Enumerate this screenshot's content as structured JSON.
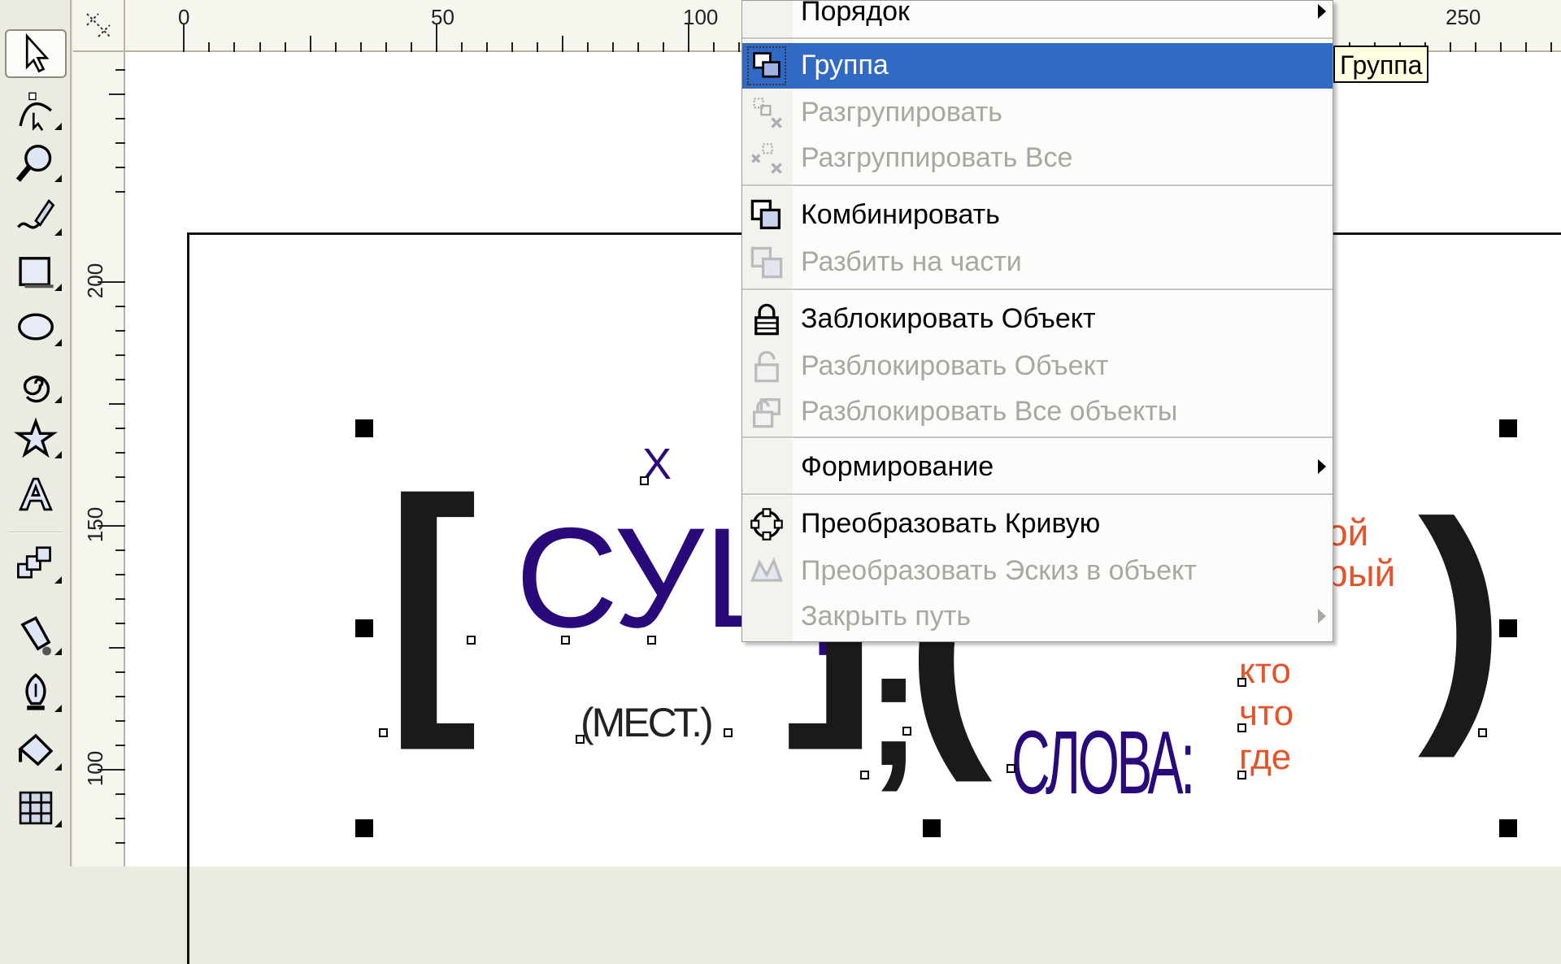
{
  "ruler": {
    "h_labels": [
      "0",
      "50",
      "100",
      "250"
    ],
    "v_labels": [
      "200",
      "150",
      "100"
    ]
  },
  "toolbox": {
    "tools": [
      {
        "name": "pick-tool",
        "icon": "arrow-pointer-icon",
        "active": true
      },
      {
        "name": "shape-tool",
        "icon": "shape-node-icon"
      },
      {
        "name": "zoom-tool",
        "icon": "magnifier-icon"
      },
      {
        "name": "freehand-tool",
        "icon": "pen-curve-icon"
      },
      {
        "name": "rectangle-tool",
        "icon": "rectangle-icon"
      },
      {
        "name": "ellipse-tool",
        "icon": "ellipse-icon"
      },
      {
        "name": "spiral-tool",
        "icon": "spiral-icon"
      },
      {
        "name": "star-tool",
        "icon": "star-icon"
      },
      {
        "name": "text-tool",
        "icon": "text-a-icon"
      },
      {
        "name": "blend-tool",
        "icon": "blend-icon"
      },
      {
        "name": "eyedropper-tool",
        "icon": "eyedropper-icon"
      },
      {
        "name": "outline-tool",
        "icon": "pen-nib-icon"
      },
      {
        "name": "fill-tool",
        "icon": "paint-bucket-icon"
      },
      {
        "name": "interactive-fill-tool",
        "icon": "mesh-grid-icon"
      }
    ]
  },
  "canvas": {
    "text_main": "СУЩ",
    "text_x": "Х",
    "text_mest": "(МЕСТ.)",
    "text_slova": "СЛОВА:",
    "text_orange_1": "ой",
    "text_orange_2": "рый",
    "text_kto": "кто",
    "text_chto": "что",
    "text_gde": "где",
    "bracket_open": "[",
    "bracket_close": "]",
    "semicolon": ";",
    "paren_open": "(",
    "paren_close": ")",
    "colors": {
      "purple": "#2a0a7a",
      "orange": "#e4542a",
      "black": "#1a1a1a"
    }
  },
  "context_menu": {
    "highlight_color": "#316ac5",
    "items": [
      {
        "label": "Порядок",
        "submenu": true,
        "disabled": false,
        "icon": ""
      },
      {
        "label": "Группа",
        "highlight": true,
        "disabled": false,
        "icon": "group-icon"
      },
      {
        "label": "Разгрупировать",
        "disabled": true,
        "icon": "ungroup-icon"
      },
      {
        "label": "Разгруппировать Все",
        "disabled": true,
        "icon": "ungroup-all-icon"
      },
      {
        "label": "Комбинировать",
        "disabled": false,
        "icon": "combine-icon"
      },
      {
        "label": "Разбить  на части",
        "disabled": true,
        "icon": "break-apart-icon"
      },
      {
        "label": "Заблокировать Объект",
        "disabled": false,
        "icon": "lock-icon"
      },
      {
        "label": "Разблокировать Объект",
        "disabled": true,
        "icon": "unlock-icon"
      },
      {
        "label": "Разблокировать Все объекты",
        "disabled": true,
        "icon": "unlock-all-icon"
      },
      {
        "label": "Формирование",
        "submenu": true,
        "disabled": false,
        "icon": ""
      },
      {
        "label": "Преобразовать Кривую",
        "disabled": false,
        "icon": "convert-curve-icon"
      },
      {
        "label": "Преобразовать Эскиз в объект",
        "disabled": true,
        "icon": "convert-sketch-icon"
      },
      {
        "label": "Закрыть путь",
        "submenu": true,
        "disabled": true,
        "icon": ""
      }
    ]
  },
  "tooltip": {
    "text": "Группа"
  }
}
